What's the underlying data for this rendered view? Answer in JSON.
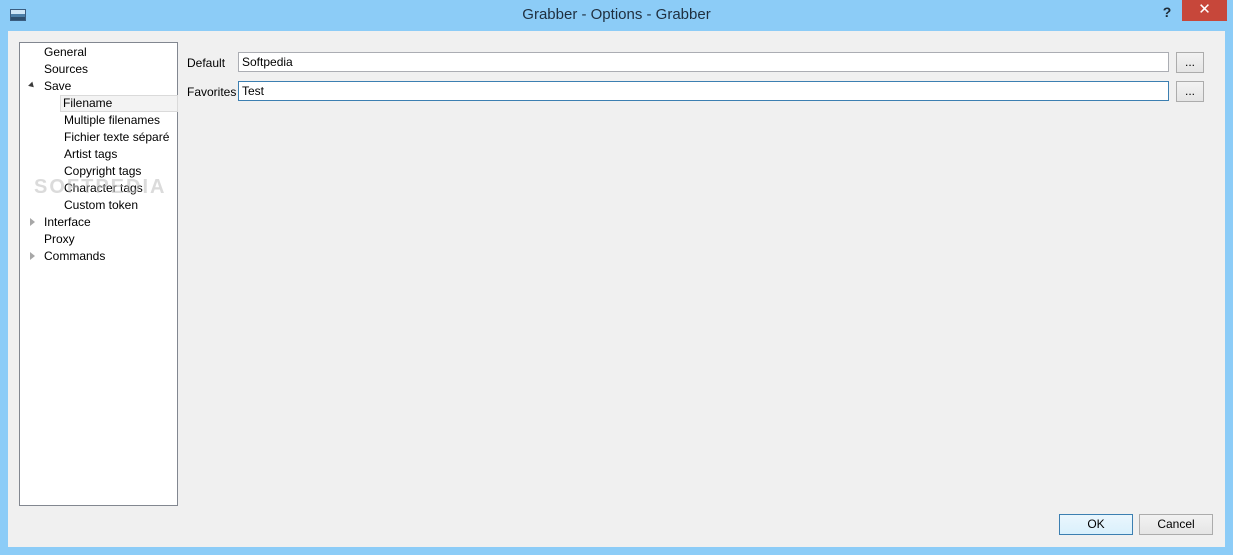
{
  "window": {
    "title": "Grabber - Options - Grabber",
    "help_label": "?",
    "close_label": "✕"
  },
  "tree": {
    "items": [
      {
        "label": "General"
      },
      {
        "label": "Sources"
      },
      {
        "label": "Save"
      },
      {
        "label": "Filename"
      },
      {
        "label": "Multiple filenames"
      },
      {
        "label": "Fichier texte séparé"
      },
      {
        "label": "Artist tags"
      },
      {
        "label": "Copyright tags"
      },
      {
        "label": "Character tags"
      },
      {
        "label": "Custom token"
      },
      {
        "label": "Interface"
      },
      {
        "label": "Proxy"
      },
      {
        "label": "Commands"
      }
    ],
    "selected": "Filename"
  },
  "form": {
    "default_label": "Default",
    "default_value": "Softpedia",
    "favorites_label": "Favorites",
    "favorites_value": "Test",
    "browse_label": "..."
  },
  "buttons": {
    "ok": "OK",
    "cancel": "Cancel"
  },
  "watermark": "SOFTPEDIA"
}
